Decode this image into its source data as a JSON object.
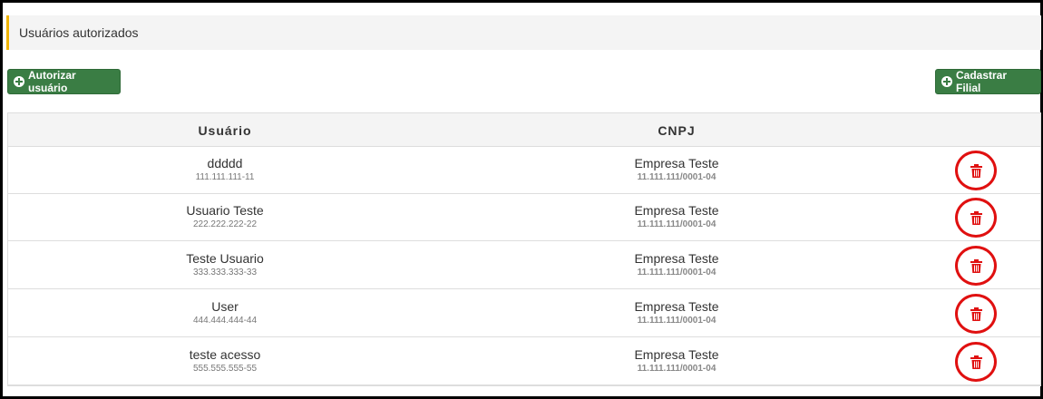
{
  "panel": {
    "title": "Usuários autorizados"
  },
  "actions": {
    "authorize_label": "Autorizar usuário",
    "register_label": "Cadastrar Filial"
  },
  "table": {
    "headers": {
      "user": "Usuário",
      "cnpj": "CNPJ"
    },
    "rows": [
      {
        "name": "ddddd",
        "cpf": "111.111.111-11",
        "company": "Empresa Teste",
        "cnpj": "11.111.111/0001-04"
      },
      {
        "name": "Usuario Teste",
        "cpf": "222.222.222-22",
        "company": "Empresa Teste",
        "cnpj": "11.111.111/0001-04"
      },
      {
        "name": "Teste Usuario",
        "cpf": "333.333.333-33",
        "company": "Empresa Teste",
        "cnpj": "11.111.111/0001-04"
      },
      {
        "name": "User",
        "cpf": "444.444.444-44",
        "company": "Empresa Teste",
        "cnpj": "11.111.111/0001-04"
      },
      {
        "name": "teste acesso",
        "cpf": "555.555.555-55",
        "company": "Empresa Teste",
        "cnpj": "11.111.111/0001-04"
      }
    ]
  },
  "colors": {
    "accent": "#f0b400",
    "button": "#3a7d44",
    "delete": "#e01010"
  }
}
